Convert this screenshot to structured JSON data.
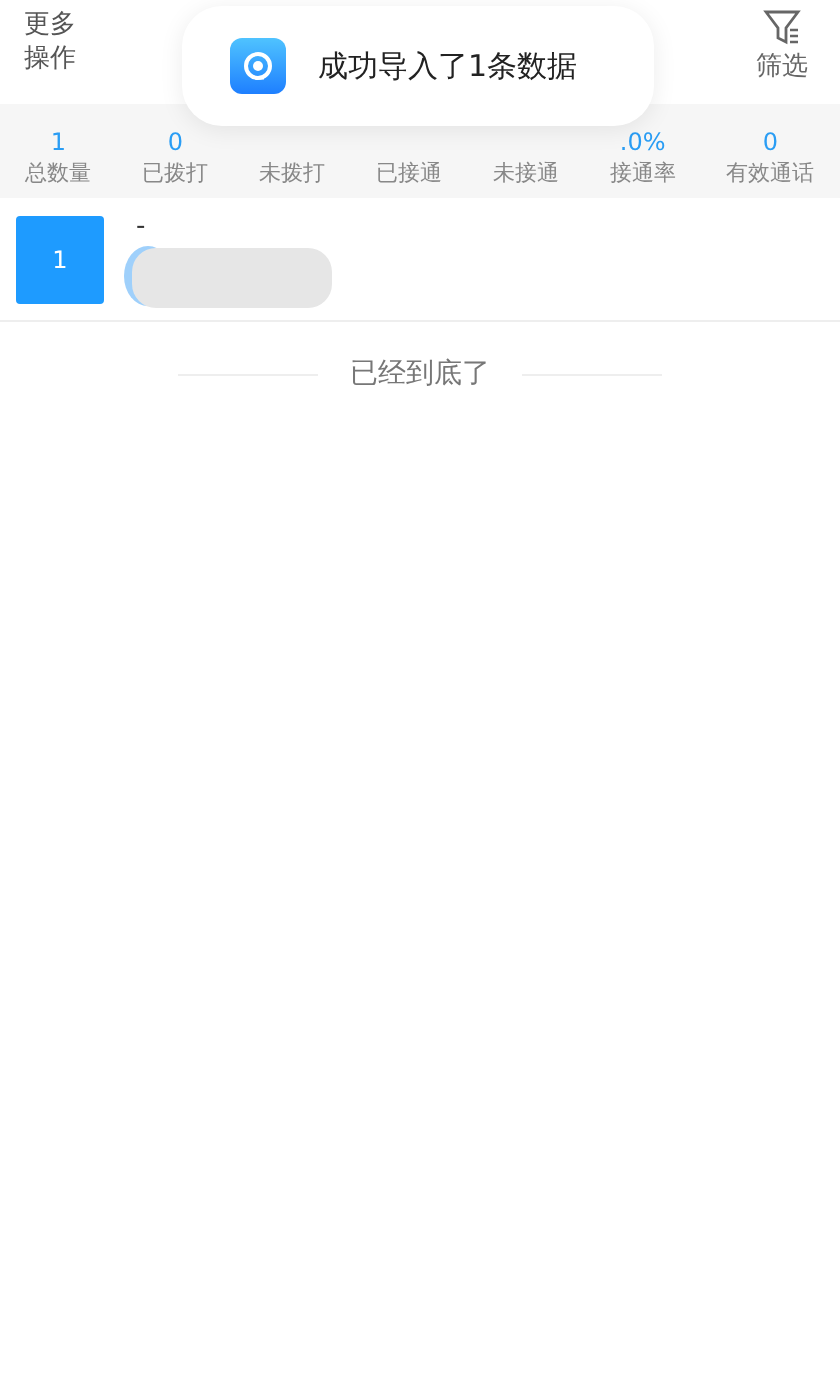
{
  "header": {
    "more_label": "更多操作",
    "filter_label": "筛选"
  },
  "toast": {
    "message": "成功导入了1条数据"
  },
  "stats": [
    {
      "value": "1",
      "label": "总数量"
    },
    {
      "value": "0",
      "label": "已拨打"
    },
    {
      "label": "未拨打"
    },
    {
      "label": "已接通"
    },
    {
      "label": "未接通"
    },
    {
      "value": ".0%",
      "label": "接通率"
    },
    {
      "value": "0",
      "label": "有效通话"
    }
  ],
  "rows": [
    {
      "index": "1",
      "name": "-"
    }
  ],
  "end_text": "已经到底了"
}
